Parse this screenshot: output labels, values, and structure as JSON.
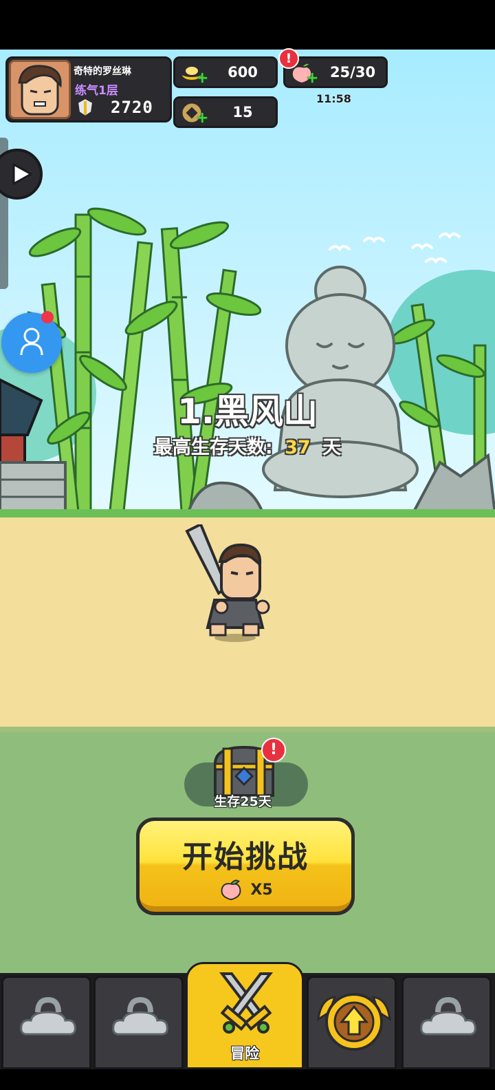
{
  "player": {
    "name": "奇特的罗丝琳",
    "rank": "练气1层",
    "power": "2720"
  },
  "resources": {
    "gold": "600",
    "coins": "15",
    "stamina": "25/30",
    "stamina_timer": "11:58",
    "plus_symbol": "+",
    "alert_symbol": "!"
  },
  "stage": {
    "title": "1.黑风山",
    "survival_label": "最高生存天数:",
    "survival_days": "37",
    "survival_unit": "天"
  },
  "chest": {
    "label": "生存25天"
  },
  "start_button": {
    "label": "开始挑战",
    "cost": "X5"
  },
  "nav": {
    "tabs": [
      {
        "label": "",
        "state": "locked"
      },
      {
        "label": "",
        "state": "locked"
      },
      {
        "label": "冒险",
        "state": "active"
      },
      {
        "label": "",
        "state": "upgrade"
      },
      {
        "label": "",
        "state": "locked"
      }
    ]
  },
  "colors": {
    "accent_yellow": "#ffe23b",
    "stamina_days": "#ffd84a",
    "rank_purple": "#c98cff",
    "alert_red": "#e8313f",
    "panel_dark": "#2b2b2f"
  }
}
